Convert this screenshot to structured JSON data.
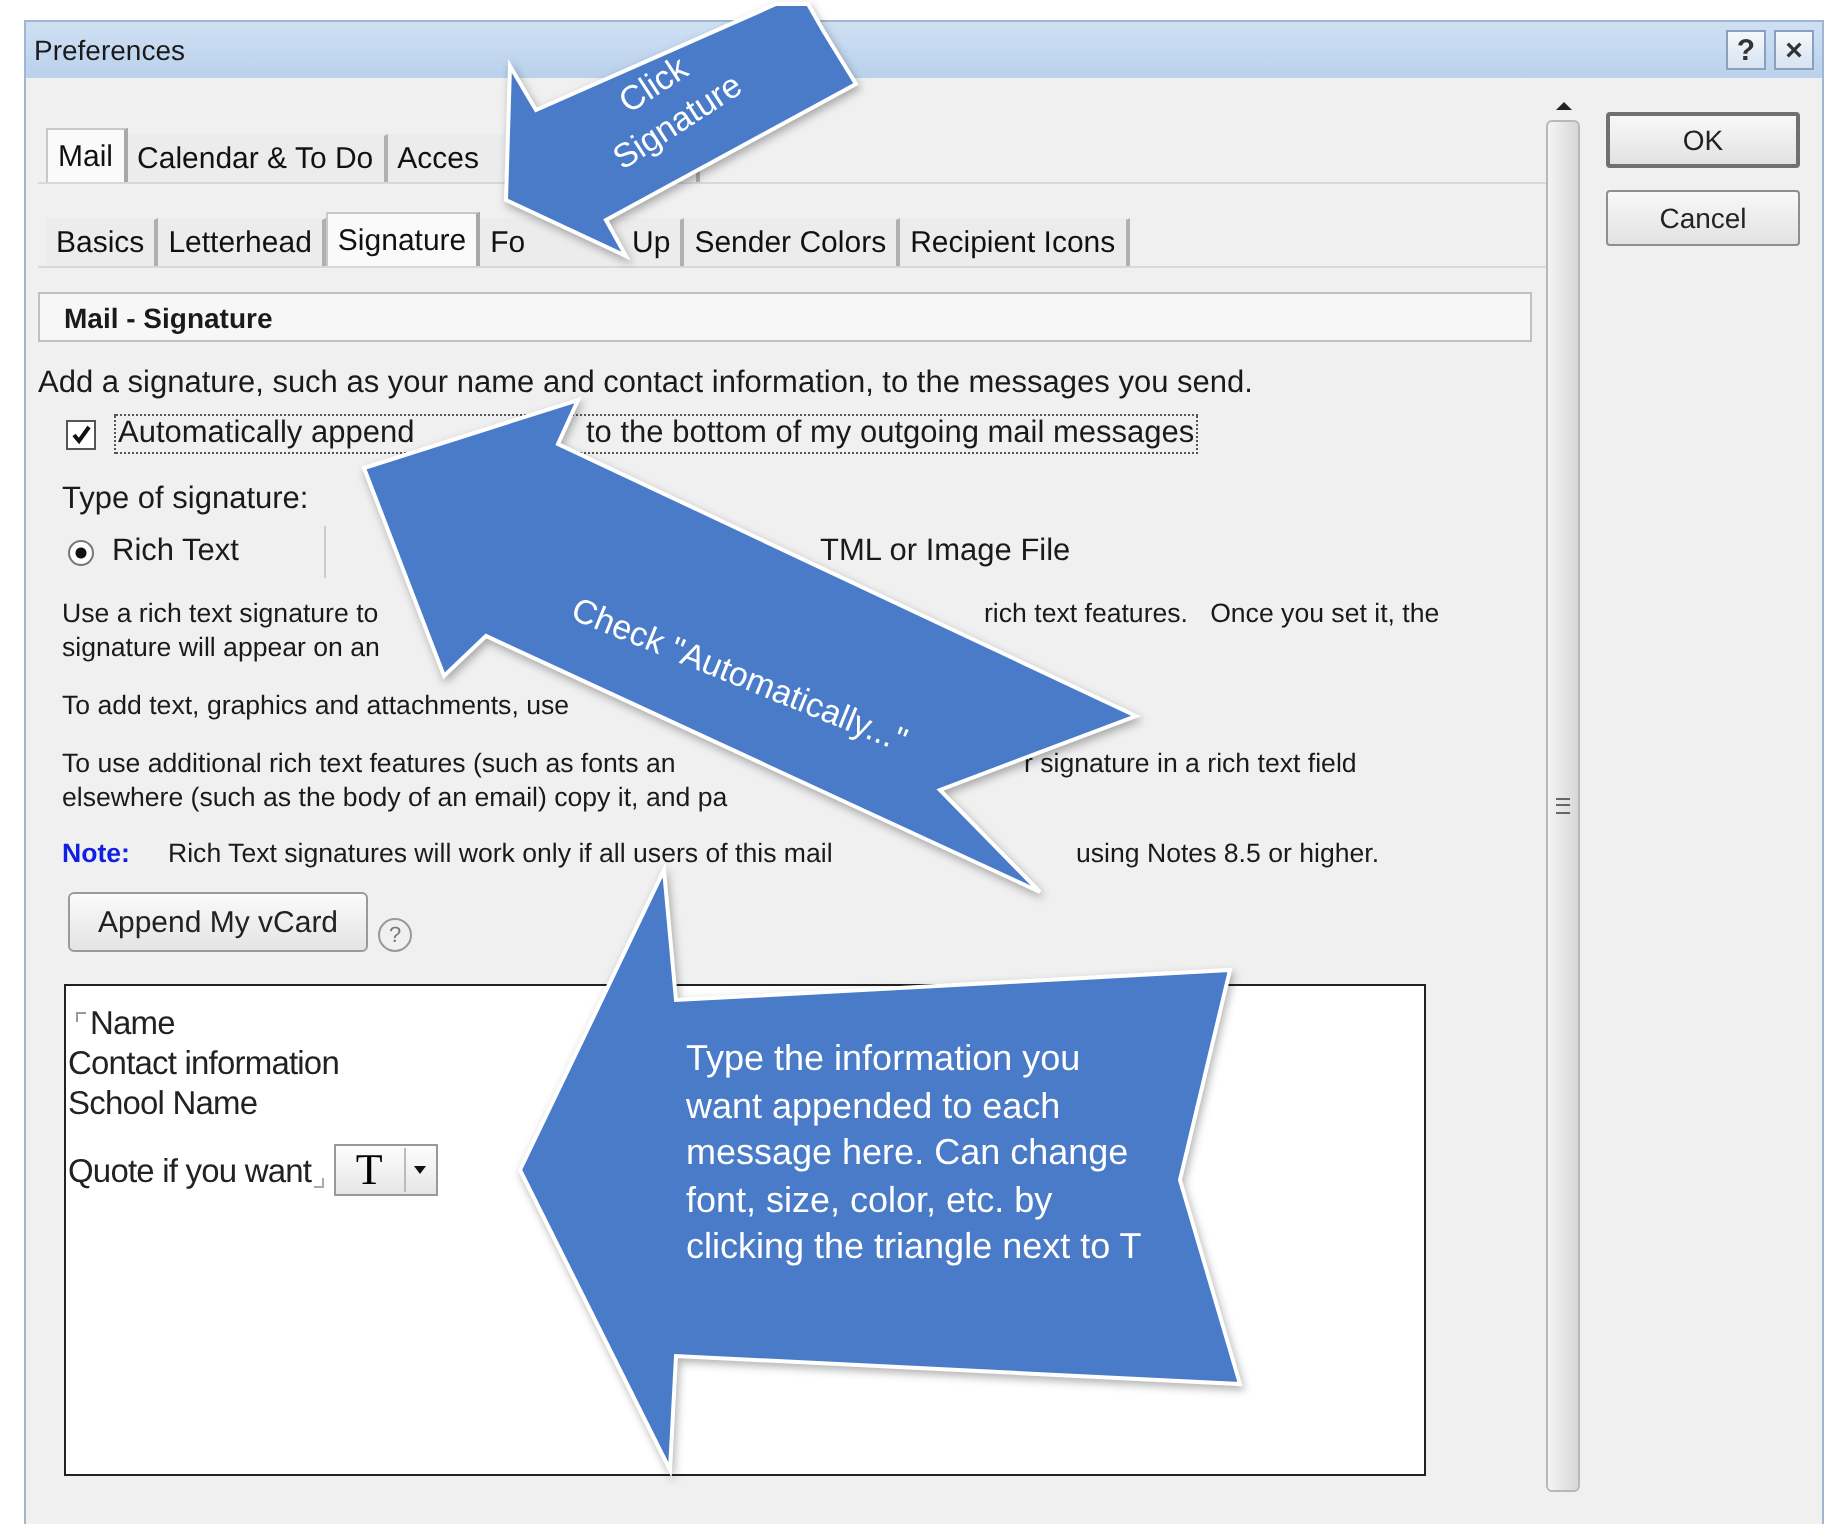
{
  "window": {
    "title": "Preferences",
    "help_button": "?",
    "close_button": "×"
  },
  "top_tabs": [
    {
      "label": "Mail",
      "selected": true
    },
    {
      "label": "Calendar & To Do",
      "selected": false
    },
    {
      "label": "Acces",
      "selected": false
    }
  ],
  "sub_tabs": [
    {
      "label": "Basics",
      "selected": false
    },
    {
      "label": "Letterhead",
      "selected": false
    },
    {
      "label": "Signature",
      "selected": true
    },
    {
      "label": "Fo",
      "label_after": "Up",
      "selected": false
    },
    {
      "label": "Sender Colors",
      "selected": false
    },
    {
      "label": "Recipient Icons",
      "selected": false
    }
  ],
  "section_title": "Mail - Signature",
  "intro": "Add a signature, such as your name and contact information, to the messages you send.",
  "auto_append": {
    "checked": true,
    "label": "Automatically append",
    "label_after": "to the bottom of my outgoing mail messages"
  },
  "signature_type_label": "Type of signature:",
  "rich_text_option": {
    "label": "Rich Text",
    "selected": true
  },
  "other_option_label": "TML or Image File",
  "paragraphs": [
    {
      "lines": [
        {
          "text": "Use a rich text signature to",
          "after": "rich text features.   Once you set it, the"
        },
        {
          "text": "signature will appear on an"
        }
      ]
    },
    {
      "lines": [
        {
          "text": "To add text, graphics and attachments, use"
        }
      ]
    },
    {
      "lines": [
        {
          "text": "To use additional rich text features (such as fonts an",
          "after": "r signature in a rich text field"
        },
        {
          "text": "elsewhere (such as the body of an email) copy it, and pa"
        }
      ]
    }
  ],
  "note": {
    "label": "Note:",
    "text": "Rich Text signatures will work only if all users of this mail",
    "after": "using Notes 8.5 or higher."
  },
  "append_button": "Append My vCard",
  "append_help": "?",
  "editor": {
    "lines": [
      "Name",
      "Contact information",
      "School Name",
      "Quote if you want"
    ],
    "font_button": "T"
  },
  "buttons": [
    "OK",
    "Cancel"
  ],
  "callouts": [
    {
      "kind": "tab",
      "text": "Click Signature"
    },
    {
      "kind": "checkbox",
      "text": "Check \"Automatically...\""
    },
    {
      "kind": "editor",
      "text": "Type the information you want appended to each message here. Can change font, size, color, etc. by clicking the triangle next to T"
    }
  ]
}
